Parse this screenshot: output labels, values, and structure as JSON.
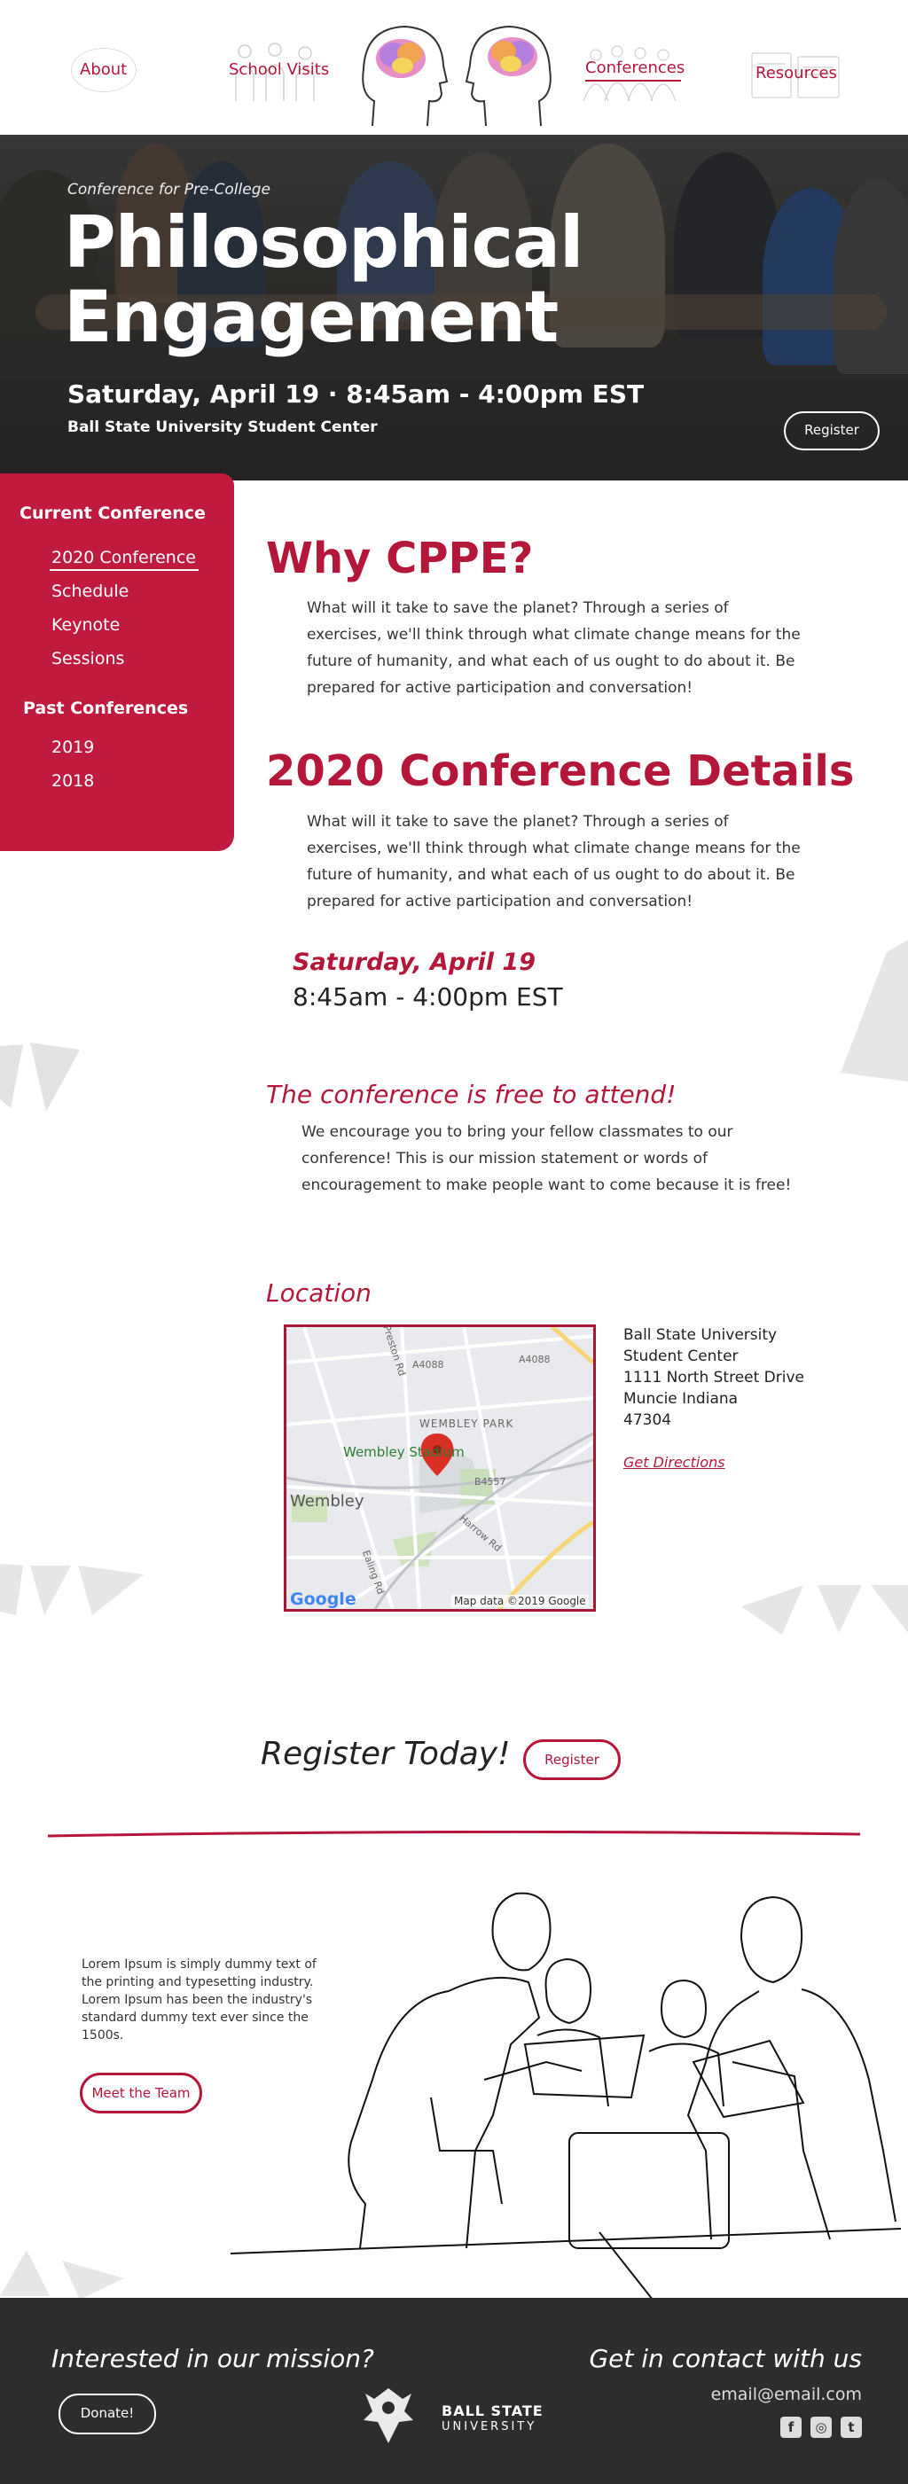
{
  "nav": {
    "about": "About",
    "school_visits": "School Visits",
    "conferences": "Conferences",
    "resources": "Resources"
  },
  "hero": {
    "subtitle": "Conference for Pre-College",
    "title_line1": "Philosophical",
    "title_line2": "Engagement",
    "date": "Saturday, April 19 · 8:45am - 4:00pm EST",
    "venue": "Ball State University Student Center",
    "register": "Register"
  },
  "sidebar": {
    "current_heading": "Current Conference",
    "current_items": [
      "2020 Conference",
      "Schedule",
      "Keynote",
      "Sessions"
    ],
    "past_heading": "Past Conferences",
    "past_items": [
      "2019",
      "2018"
    ]
  },
  "why": {
    "heading": "Why CPPE?",
    "text": "What will it take to save the planet? Through a series of exercises, we'll think through what climate change means for the future of humanity, and what each of us ought to do about it. Be prepared for active participation and conversation!"
  },
  "details": {
    "heading": "2020 Conference Details",
    "text": "What will it take to save the planet? Through a series of exercises, we'll think through what climate change means for the future of humanity, and what each of us ought to do about it. Be prepared for active participation and conversation!",
    "date": "Saturday, April 19",
    "time": "8:45am - 4:00pm EST"
  },
  "free": {
    "heading": "The conference is free to attend!",
    "text": "We encourage you to bring your fellow classmates to our conference! This is our mission statement or words of encouragement to make people want to come because it is free!"
  },
  "location": {
    "heading": "Location",
    "address_lines": [
      "Ball State University",
      "Student Center",
      "1111 North Street Drive",
      "Muncie Indiana",
      "47304"
    ],
    "directions": "Get Directions",
    "map": {
      "district": "WEMBLEY PARK",
      "stadium": "Wembley Stadium",
      "area": "Wembley",
      "road1": "A4088",
      "road2": "A4088",
      "road3": "B4557",
      "road4": "Preston Rd",
      "road5": "Harrow Rd",
      "road6": "Ealing Rd",
      "logo": "Google",
      "attribution": "Map data ©2019 Google"
    }
  },
  "register_today": {
    "heading": "Register Today!",
    "button": "Register"
  },
  "team": {
    "text": "Lorem Ipsum is simply dummy text of the printing and typesetting industry. Lorem Ipsum has been the industry's standard dummy text ever since the 1500s.",
    "button": "Meet the Team"
  },
  "footer": {
    "mission": "Interested in our mission?",
    "donate": "Donate!",
    "contact": "Get in contact with us",
    "email": "email@email.com",
    "logo_line1": "BALL STATE",
    "logo_line2": "UNIVERSITY",
    "socials": [
      "f",
      "◎",
      "t"
    ]
  },
  "colors": {
    "accent": "#b4173a",
    "footer_bg": "#2d2d2d"
  }
}
